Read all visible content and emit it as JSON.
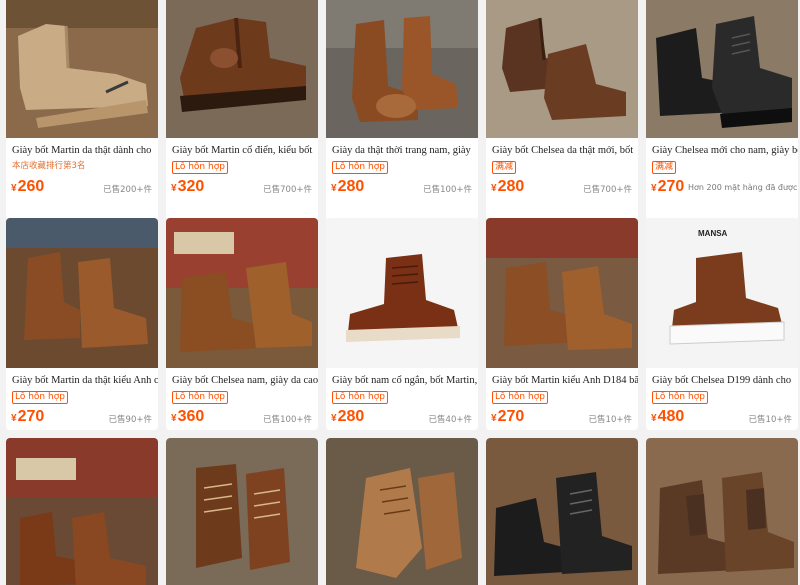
{
  "colors": {
    "price": "#ff5000",
    "tag_border": "#ff5000",
    "background": "#f2f2f2"
  },
  "products": [
    {
      "title": "Giày bốt Martin da thật dành cho",
      "tag": "本店收藏排行第3名",
      "currency": "¥",
      "price": "260",
      "sold": "已售200+件",
      "image": "suede-chelsea-boot"
    },
    {
      "title": "Giày bốt Martin cổ điển, kiểu bốt",
      "tag": "Lô hỗn hợp",
      "currency": "¥",
      "price": "320",
      "sold": "已售700+件",
      "image": "brown-chelsea-boot"
    },
    {
      "title": "Giày da thật thời trang nam, giày",
      "tag": "Lô hỗn hợp",
      "currency": "¥",
      "price": "280",
      "sold": "已售100+件",
      "image": "brown-leather-boots-pair"
    },
    {
      "title": "Giày bốt Chelsea da thật mới, bốt",
      "tag": "满减",
      "currency": "¥",
      "price": "280",
      "sold": "已售700+件",
      "image": "brown-chelsea-boots-pair"
    },
    {
      "title": "Giày Chelsea mới cho nam, giày bốt",
      "tag": "满减",
      "currency": "¥",
      "price": "270",
      "sold": "Hơn 200 mặt hàng đã được bán",
      "image": "black-lace-boot"
    },
    {
      "title": "Giày bốt Martin da thật kiểu Anh cổ",
      "tag": "Lô hỗn hợp",
      "currency": "¥",
      "price": "270",
      "sold": "已售90+件",
      "image": "vintage-chelsea-boots"
    },
    {
      "title": "Giày bốt Chelsea nam, giày da cao",
      "tag": "Lô hỗn hợp",
      "currency": "¥",
      "price": "360",
      "sold": "已售100+件",
      "image": "brown-work-boot"
    },
    {
      "title": "Giày bốt nam cổ ngắn, bốt Martin,",
      "tag": "Lô hỗn hợp",
      "currency": "¥",
      "price": "280",
      "sold": "已售40+件",
      "image": "red-work-boot"
    },
    {
      "title": "Giày bốt Martin kiểu Anh D184 băng",
      "tag": "Lô hỗn hợp",
      "currency": "¥",
      "price": "270",
      "sold": "已售10+件",
      "image": "brown-chelsea-boot-2"
    },
    {
      "title": "Giày bốt Chelsea D199 dành cho",
      "tag": "Lô hỗn hợp",
      "currency": "¥",
      "price": "480",
      "sold": "已售10+件",
      "image": "mansa-lace-boot",
      "brand": "MANSA"
    },
    {
      "title": "",
      "tag": "",
      "currency": "",
      "price": "",
      "sold": "",
      "image": "chelsea-boots-poster"
    },
    {
      "title": "",
      "tag": "",
      "currency": "",
      "price": "",
      "sold": "",
      "image": "lace-up-boots-pair"
    },
    {
      "title": "",
      "tag": "",
      "currency": "",
      "price": "",
      "sold": "",
      "image": "tan-lace-boot"
    },
    {
      "title": "",
      "tag": "",
      "currency": "",
      "price": "",
      "sold": "",
      "image": "black-boots-pair"
    },
    {
      "title": "",
      "tag": "",
      "currency": "",
      "price": "",
      "sold": "",
      "image": "suede-chelsea-boots"
    }
  ]
}
